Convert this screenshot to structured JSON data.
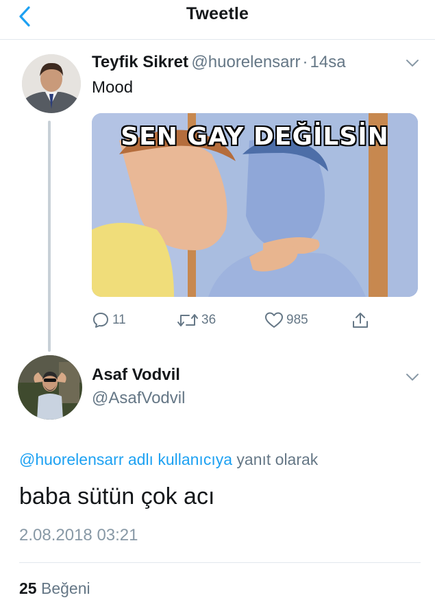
{
  "header": {
    "title": "Tweetle"
  },
  "original_tweet": {
    "display_name": "Teyfik Sikret",
    "handle": "@huorelensarr",
    "separator": "·",
    "time": "14sa",
    "text": "Mood",
    "image_caption": "SEN GAY DEĞİLSİN",
    "actions": {
      "replies": "11",
      "retweets": "36",
      "likes": "985"
    }
  },
  "reply_tweet": {
    "display_name": "Asaf Vodvil",
    "handle": "@AsafVodvil",
    "reply_to_link": "@huorelensarr adlı kullanıcıya",
    "reply_to_suffix": "yanıt olarak",
    "text": "baba sütün çok acı",
    "timestamp": "2.08.2018 03:21",
    "likes_count": "25",
    "likes_label": "Beğeni"
  },
  "colors": {
    "accent": "#1da1f2",
    "muted": "#657786",
    "divider": "#e1e8ed"
  }
}
